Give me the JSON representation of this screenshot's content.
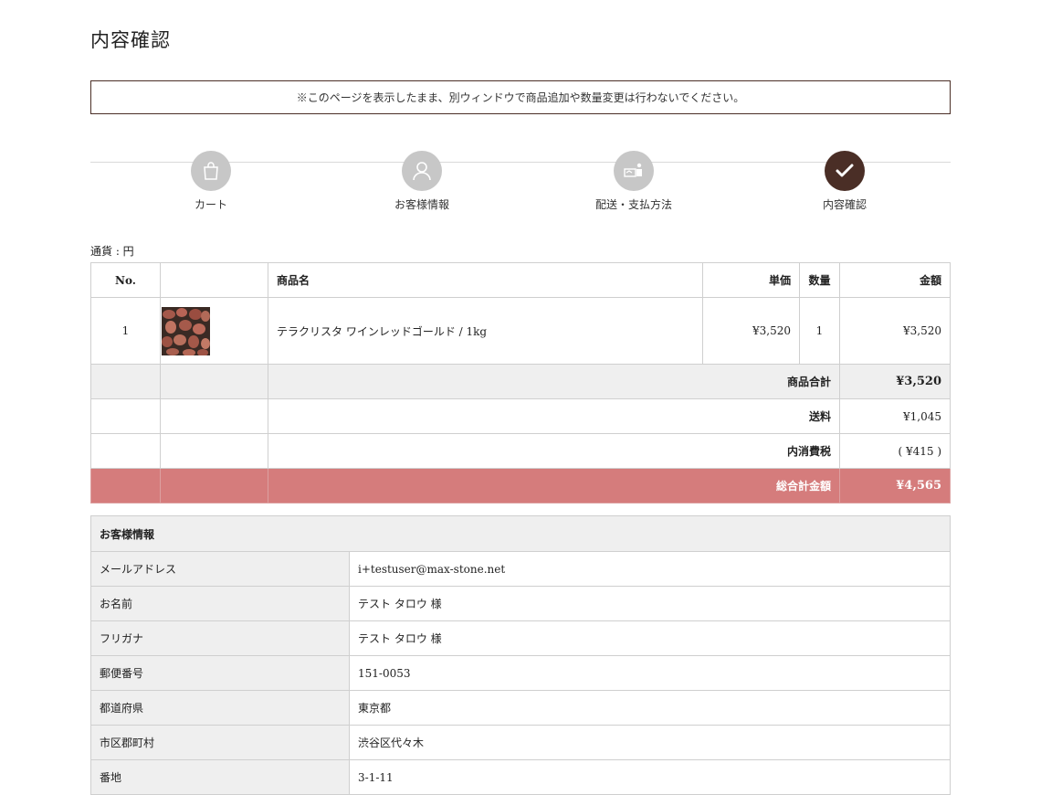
{
  "page": {
    "title": "内容確認",
    "notice": "※このページを表示したまま、別ウィンドウで商品追加や数量変更は行わないでください。"
  },
  "steps": [
    {
      "label": "カート",
      "icon": "shopping-bag-icon",
      "active": false
    },
    {
      "label": "お客様情報",
      "icon": "user-icon",
      "active": false
    },
    {
      "label": "配送・支払方法",
      "icon": "delivery-payment-icon",
      "active": false
    },
    {
      "label": "内容確認",
      "icon": "checkmark-icon",
      "active": true
    }
  ],
  "colors": {
    "accent_dark": "#4a2e26",
    "step_inactive": "#c7c7c7",
    "total_row": "#d57c7c",
    "row_gray": "#efefef"
  },
  "cart": {
    "currency_label": "通貨 : 円",
    "headers": {
      "no": "No.",
      "image": "",
      "name": "商品名",
      "price": "単価",
      "qty": "数量",
      "amount": "金額"
    },
    "items": [
      {
        "no": "1",
        "name": "テラクリスタ ワインレッドゴールド / 1kg",
        "price": "¥3,520",
        "qty": "1",
        "amount": "¥3,520"
      }
    ],
    "summary": {
      "subtotal_label": "商品合計",
      "subtotal": "¥3,520",
      "shipping_label": "送料",
      "shipping": "¥1,045",
      "tax_label": "内消費税",
      "tax": "( ¥415 )",
      "total_label": "総合計金額",
      "total": "¥4,565"
    }
  },
  "customer": {
    "heading": "お客様情報",
    "rows": [
      {
        "label": "メールアドレス",
        "value": "i+testuser@max-stone.net"
      },
      {
        "label": "お名前",
        "value": "テスト タロウ 様"
      },
      {
        "label": "フリガナ",
        "value": "テスト タロウ 様"
      },
      {
        "label": "郵便番号",
        "value": "151-0053"
      },
      {
        "label": "都道府県",
        "value": "東京都"
      },
      {
        "label": "市区郡町村",
        "value": "渋谷区代々木"
      },
      {
        "label": "番地",
        "value": "3-1-11"
      }
    ]
  }
}
